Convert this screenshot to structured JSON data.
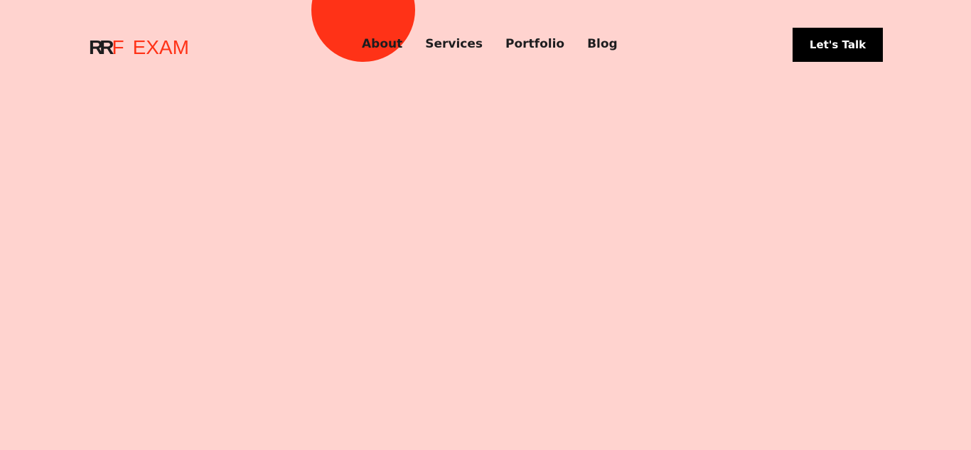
{
  "brand": {
    "mark": "RR",
    "mark_accent": "F",
    "name": "EXAM"
  },
  "nav": {
    "items": [
      "About",
      "Services",
      "Portfolio",
      "Blog"
    ]
  },
  "cta": {
    "label": "Let's Talk"
  },
  "colors": {
    "background": "#ffd3cf",
    "accent": "#ff3217",
    "text": "#1d1d1f",
    "button": "#000000",
    "button_text": "#ffffff"
  }
}
